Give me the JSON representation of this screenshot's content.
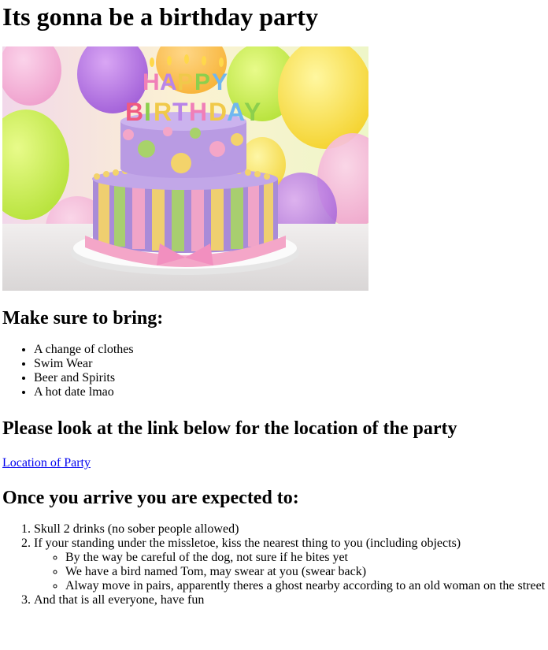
{
  "page": {
    "title": "Its gonna be a birthday party"
  },
  "hero_image": {
    "alt": "Birthday cake",
    "topper_line1": "HAPPY",
    "topper_line2": "BIRTHDAY",
    "colors": {
      "cake_purple": "#a98bd8",
      "cake_pink": "#f4a6c8",
      "cake_yellow": "#f3d36b",
      "cake_green": "#a8d26a",
      "plate": "#f3f3f3"
    }
  },
  "bring_section": {
    "heading": "Make sure to bring:",
    "items": [
      "A change of clothes",
      "Swim Wear",
      "Beer and Spirits",
      "A hot date lmao"
    ]
  },
  "location_section": {
    "heading": "Please look at the link below for the location of the party",
    "link_text": "Location of Party",
    "link_color": "#0000ee"
  },
  "arrive_section": {
    "heading": "Once you arrive you are expected to:",
    "items": [
      "Skull 2 drinks (no sober people allowed)",
      "If your standing under the missletoe, kiss the nearest thing to you (including objects)",
      "And that is all everyone, have fun"
    ],
    "subitems": [
      "By the way be careful of the dog, not sure if he bites yet",
      "We have a bird named Tom, may swear at you (swear back)",
      "Alway move in pairs, apparently theres a ghost nearby according to an old woman on the street"
    ]
  }
}
